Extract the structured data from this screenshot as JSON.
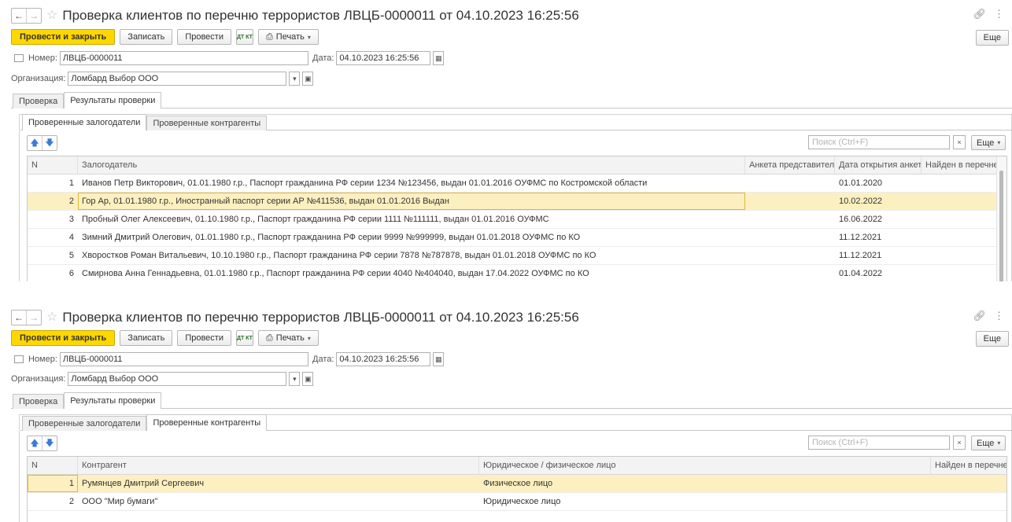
{
  "doc": {
    "title": "Проверка клиентов по перечню террористов ЛВЦБ-0000011 от 04.10.2023 16:25:56",
    "nav_back": "←",
    "nav_forward": "→",
    "star": "☆",
    "link_icon": "link-icon",
    "menu_icon": "⋮"
  },
  "toolbar": {
    "post_close": "Провести и закрыть",
    "save": "Записать",
    "post": "Провести",
    "dtkt": "ДТ КТ",
    "print": "Печать",
    "more": "Еще"
  },
  "fields": {
    "number_label": "Номер:",
    "number_value": "ЛВЦБ-0000011",
    "date_label": "Дата:",
    "date_value": "04.10.2023 16:25:56",
    "org_label": "Организация:",
    "org_value": "Ломбард Выбор ООО"
  },
  "tabs": {
    "check": "Проверка",
    "results": "Результаты проверки",
    "pledgers": "Проверенные залогодатели",
    "contractors": "Проверенные контрагенты"
  },
  "search": {
    "placeholder": "Поиск (Ctrl+F)",
    "clear": "×",
    "more": "Еще"
  },
  "grid1": {
    "headers": [
      "N",
      "Залогодатель",
      "Анкета представителя",
      "Дата открытия анкеты",
      "Найден в перечне"
    ],
    "rows": [
      {
        "n": "1",
        "name": "Иванов Петр Викторович, 01.01.1980 г.р., Паспорт гражданина РФ серии 1234 №123456, выдан 01.01.2016 ОУФМС по Костромской области",
        "rep": "",
        "date": "01.01.2020",
        "found": ""
      },
      {
        "n": "2",
        "name": "Гор Ар, 01.01.1980 г.р., Иностранный паспорт серии АР №411536, выдан 01.01.2016 Выдан",
        "rep": "",
        "date": "10.02.2022",
        "found": ""
      },
      {
        "n": "3",
        "name": "Пробный Олег Алексеевич, 01.10.1980 г.р., Паспорт гражданина РФ серии 1111 №111111, выдан 01.01.2016 ОУФМС",
        "rep": "",
        "date": "16.06.2022",
        "found": ""
      },
      {
        "n": "4",
        "name": "Зимний Дмитрий Олегович, 01.01.1980 г.р., Паспорт гражданина РФ серии 9999 №999999, выдан 01.01.2018 ОУФМС по КО",
        "rep": "",
        "date": "11.12.2021",
        "found": ""
      },
      {
        "n": "5",
        "name": "Хворостков Роман Витальевич, 10.10.1980 г.р., Паспорт гражданина РФ серии 7878 №787878, выдан 01.01.2018 ОУФМС по КО",
        "rep": "",
        "date": "11.12.2021",
        "found": ""
      },
      {
        "n": "6",
        "name": "Смирнова Анна Геннадьевна, 01.01.1980 г.р., Паспорт гражданина РФ серии 4040 №404040, выдан 17.04.2022 ОУФМС по КО",
        "rep": "",
        "date": "01.04.2022",
        "found": ""
      }
    ]
  },
  "grid2": {
    "headers": [
      "N",
      "Контрагент",
      "Юридическое / физическое лицо",
      "Найден в перечне"
    ],
    "rows": [
      {
        "n": "1",
        "name": "Румянцев Дмитрий Сергеевич",
        "type": "Физическое лицо",
        "found": ""
      },
      {
        "n": "2",
        "name": "ООО \"Мир бумаги\"",
        "type": "Юридическое лицо",
        "found": ""
      }
    ]
  }
}
